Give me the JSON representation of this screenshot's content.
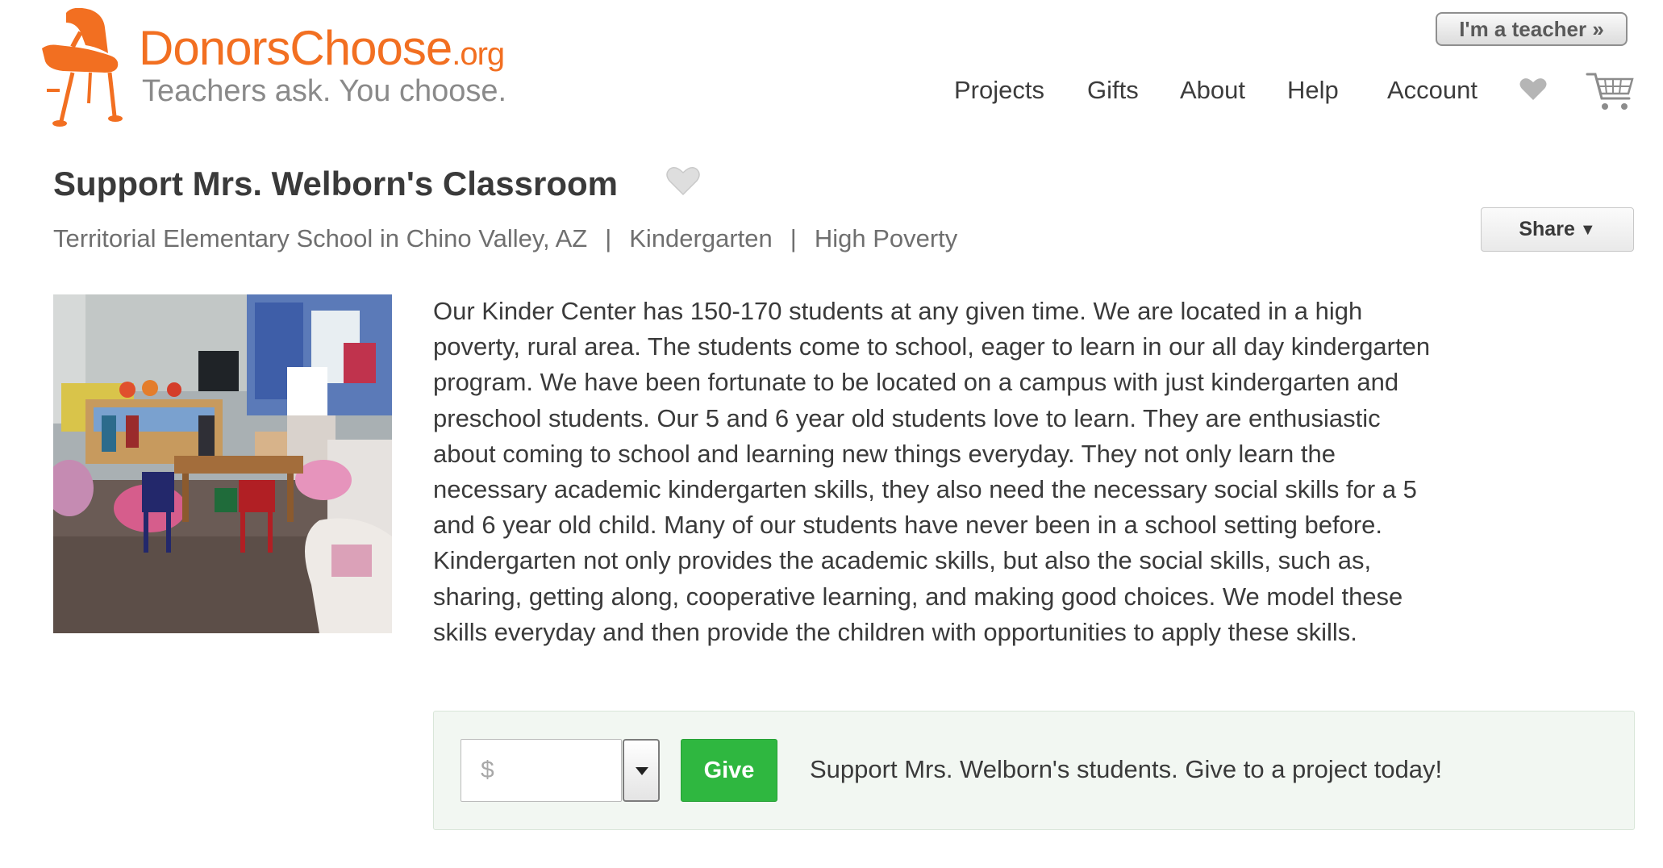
{
  "header": {
    "logo": {
      "name_main": "DonorsChoose",
      "name_suffix": ".org",
      "tagline": "Teachers ask. You choose."
    },
    "teacher_button": "I'm a teacher »",
    "nav": {
      "projects": "Projects",
      "gifts": "Gifts",
      "about": "About",
      "help": "Help",
      "account": "Account"
    },
    "icons": {
      "favorites": "heart-icon",
      "cart": "cart-icon"
    }
  },
  "page": {
    "title": "Support Mrs. Welborn's Classroom",
    "school": "Territorial Elementary School in Chino Valley, AZ",
    "separator": "|",
    "grade": "Kindergarten",
    "poverty": "High Poverty",
    "share_label": "Share",
    "photo_icon": "classroom-photo"
  },
  "description": "Our Kinder Center has 150-170 students at any given time. We are located in a high poverty, rural area. The students come to school, eager to learn in our all day kindergarten program. We have been fortunate to be located on a campus with just kindergarten and preschool students. Our 5 and 6 year old students love to learn. They are enthusiastic about coming to school and learning new things everyday. They not only learn the necessary academic kindergarten skills, they also need the necessary social skills for a 5 and 6 year old child. Many of our students have never been in a school setting before. Kindergarten not only provides the academic skills, but also the social skills, such as, sharing, getting along, cooperative learning, and making good choices. We model these skills everyday and then provide the children with opportunities to apply these skills.",
  "give": {
    "amount_placeholder": "$",
    "amount_value": "",
    "button_label": "Give",
    "message": "Support Mrs. Welborn's students. Give to a project today!"
  },
  "colors": {
    "brand_orange": "#f26f21",
    "give_green": "#2fb740",
    "give_box_bg": "#f2f7f2"
  }
}
